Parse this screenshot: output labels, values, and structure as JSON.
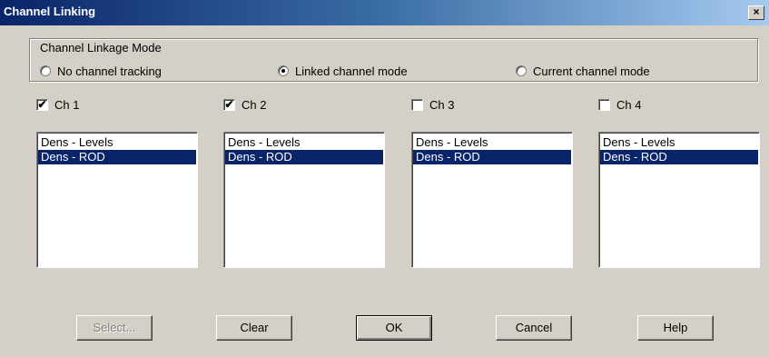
{
  "window": {
    "title": "Channel Linking",
    "close_glyph": "×"
  },
  "mode_group": {
    "label": "Channel Linkage Mode",
    "options": [
      {
        "label": "No channel tracking",
        "selected": false
      },
      {
        "label": "Linked channel mode",
        "selected": true
      },
      {
        "label": "Current channel mode",
        "selected": false
      }
    ]
  },
  "channels": [
    {
      "label": "Ch 1",
      "checked": true,
      "check_glyph": "✔",
      "items": [
        "Dens - Levels",
        "Dens - ROD"
      ],
      "selected_index": 1
    },
    {
      "label": "Ch 2",
      "checked": true,
      "check_glyph": "✔",
      "items": [
        "Dens - Levels",
        "Dens - ROD"
      ],
      "selected_index": 1
    },
    {
      "label": "Ch 3",
      "checked": false,
      "check_glyph": "",
      "items": [
        "Dens - Levels",
        "Dens - ROD"
      ],
      "selected_index": 1
    },
    {
      "label": "Ch 4",
      "checked": false,
      "check_glyph": "",
      "items": [
        "Dens - Levels",
        "Dens - ROD"
      ],
      "selected_index": 1
    }
  ],
  "buttons": {
    "select": "Select...",
    "clear": "Clear",
    "ok": "OK",
    "cancel": "Cancel",
    "help": "Help"
  }
}
